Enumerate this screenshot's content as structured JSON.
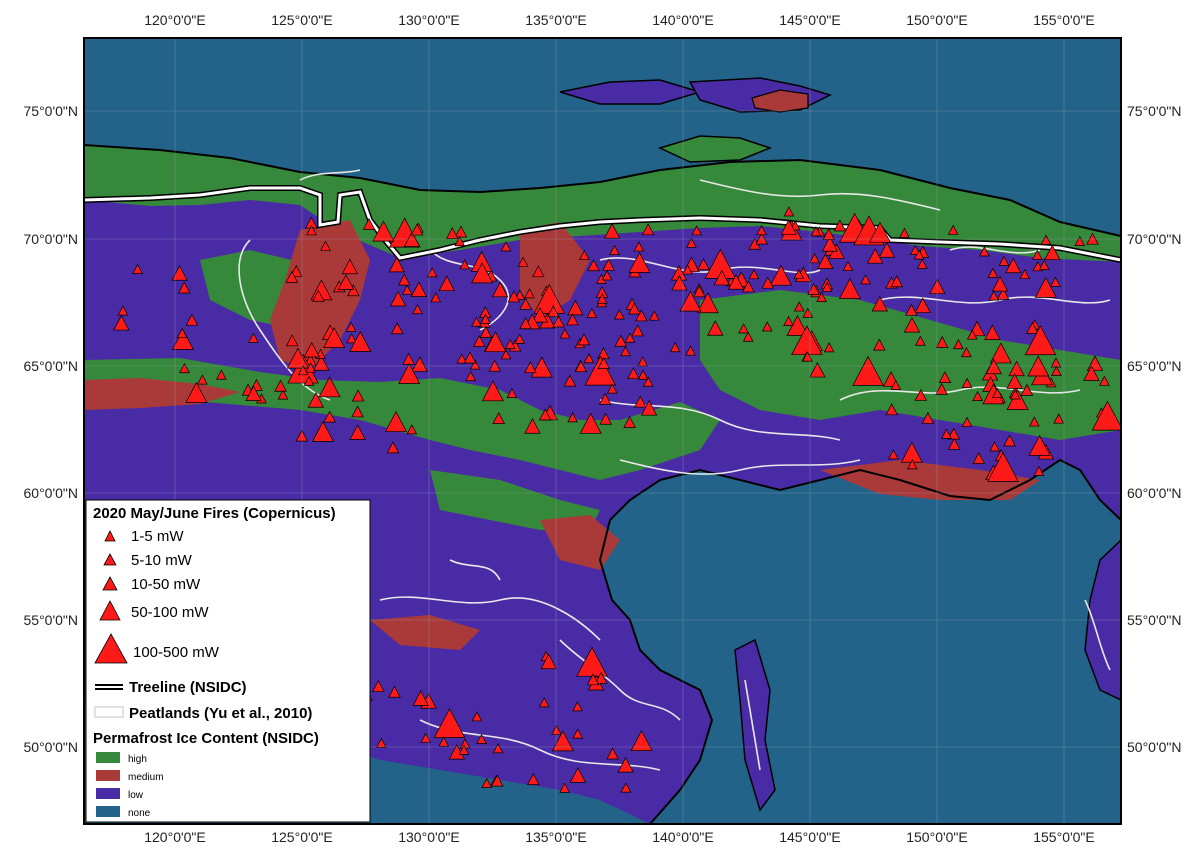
{
  "map": {
    "lon_ticks": [
      "120°0'0\"E",
      "125°0'0\"E",
      "130°0'0\"E",
      "135°0'0\"E",
      "140°0'0\"E",
      "145°0'0\"E",
      "150°0'0\"E",
      "155°0'0\"E"
    ],
    "lat_ticks": [
      "75°0'0\"N",
      "70°0'0\"N",
      "65°0'0\"N",
      "60°0'0\"N",
      "55°0'0\"N",
      "50°0'0\"N"
    ],
    "colors": {
      "ocean": "#23638a",
      "high": "#36883a",
      "medium": "#aa3a3a",
      "low": "#4a2ba6",
      "none": "#23638a",
      "fire": "#ff1a1a",
      "peat": "#e8e8e8",
      "treeline": "#ffffff"
    }
  },
  "legend": {
    "fires_title": "2020 May/June Fires (Copernicus)",
    "fire_classes": [
      "1-5 mW",
      "5-10 mW",
      "10-50 mW",
      "50-100 mW",
      "100-500 mW"
    ],
    "treeline_label": "Treeline (NSIDC)",
    "peatlands_label": "Peatlands (Yu et al., 2010)",
    "permafrost_title": "Permafrost Ice Content (NSIDC)",
    "permafrost_classes": [
      "high",
      "medium",
      "low",
      "none"
    ]
  }
}
